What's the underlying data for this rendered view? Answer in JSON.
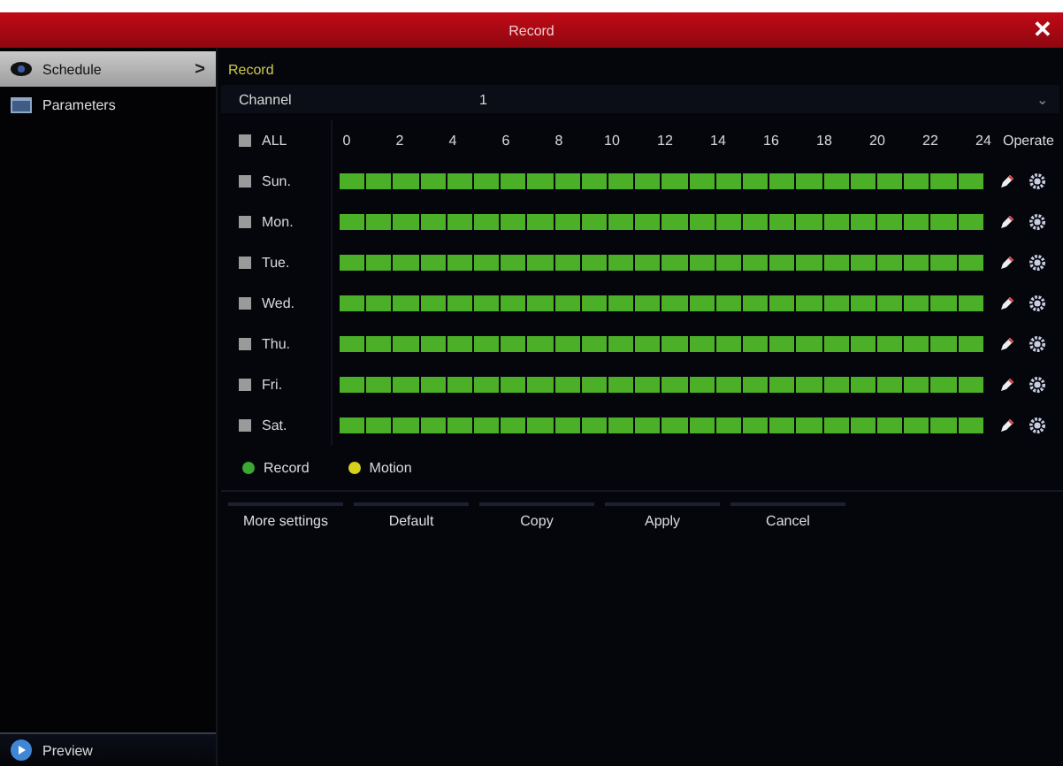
{
  "window": {
    "title": "Record",
    "close": "✕"
  },
  "sidebar": {
    "items": [
      {
        "label": "Schedule",
        "selected": true,
        "arrow": ">"
      },
      {
        "label": "Parameters",
        "selected": false
      }
    ],
    "footer": {
      "label": "Preview"
    }
  },
  "section_title": "Record",
  "channel": {
    "label": "Channel",
    "value": "1",
    "caret": "⌄"
  },
  "schedule": {
    "all_label": "ALL",
    "all_checked": false,
    "hour_labels": [
      "0",
      "2",
      "4",
      "6",
      "8",
      "10",
      "12",
      "14",
      "16",
      "18",
      "20",
      "22",
      "24"
    ],
    "operate_label": "Operate",
    "days": [
      {
        "label": "Sun.",
        "checked": false,
        "recording_all_day": true
      },
      {
        "label": "Mon.",
        "checked": false,
        "recording_all_day": true
      },
      {
        "label": "Tue.",
        "checked": false,
        "recording_all_day": true
      },
      {
        "label": "Wed.",
        "checked": false,
        "recording_all_day": true
      },
      {
        "label": "Thu.",
        "checked": false,
        "recording_all_day": true
      },
      {
        "label": "Fri.",
        "checked": false,
        "recording_all_day": true
      },
      {
        "label": "Sat.",
        "checked": false,
        "recording_all_day": true
      }
    ]
  },
  "legend": [
    {
      "label": "Record",
      "color": "#3aa832"
    },
    {
      "label": "Motion",
      "color": "#d8d21c"
    }
  ],
  "buttons": [
    "More settings",
    "Default",
    "Copy",
    "Apply",
    "Cancel"
  ]
}
